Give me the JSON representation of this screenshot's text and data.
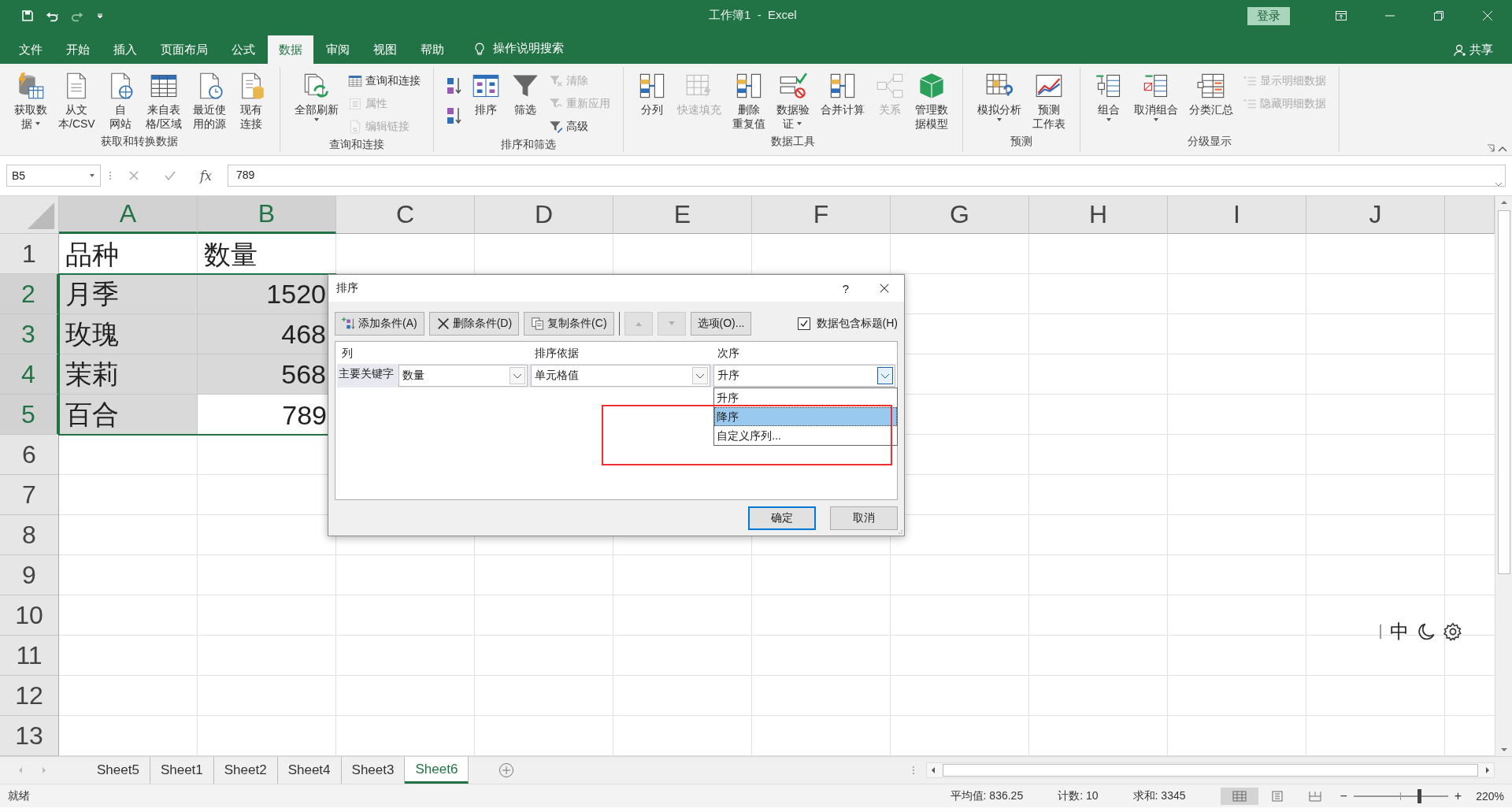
{
  "title_bar": {
    "title": "工作簿1  -  Excel",
    "signin": "登录"
  },
  "menu_tabs": [
    {
      "label": "文件",
      "selected": false
    },
    {
      "label": "开始",
      "selected": false
    },
    {
      "label": "插入",
      "selected": false
    },
    {
      "label": "页面布局",
      "selected": false
    },
    {
      "label": "公式",
      "selected": false
    },
    {
      "label": "数据",
      "selected": true
    },
    {
      "label": "审阅",
      "selected": false
    },
    {
      "label": "视图",
      "selected": false
    },
    {
      "label": "帮助",
      "selected": false
    }
  ],
  "tell_me": "操作说明搜索",
  "share": "共享",
  "ribbon": {
    "groups": [
      {
        "label": "获取和转换数据",
        "items": [
          {
            "kind": "large",
            "lines": [
              "获取数",
              "据"
            ],
            "dropdown": true,
            "disabled": false
          },
          {
            "kind": "large",
            "lines": [
              "从文",
              "本/CSV"
            ],
            "dropdown": false,
            "disabled": false
          },
          {
            "kind": "large",
            "lines": [
              "自",
              "网站"
            ],
            "dropdown": false,
            "disabled": false
          },
          {
            "kind": "large",
            "lines": [
              "来自表",
              "格/区域"
            ],
            "dropdown": false,
            "disabled": false
          },
          {
            "kind": "large",
            "lines": [
              "最近使",
              "用的源"
            ],
            "dropdown": false,
            "disabled": false
          },
          {
            "kind": "large",
            "lines": [
              "现有",
              "连接"
            ],
            "dropdown": false,
            "disabled": false
          }
        ]
      },
      {
        "label": "查询和连接",
        "items": [
          {
            "kind": "large",
            "lines": [
              "全部刷新"
            ],
            "dropdown": true,
            "disabled": false
          },
          {
            "kind": "stack",
            "items": [
              {
                "label": "查询和连接",
                "disabled": false
              },
              {
                "label": "属性",
                "disabled": true
              },
              {
                "label": "编辑链接",
                "disabled": true
              }
            ]
          }
        ]
      },
      {
        "label": "排序和筛选",
        "items": [
          {
            "kind": "sort_pair"
          },
          {
            "kind": "large",
            "lines": [
              "排序"
            ],
            "dropdown": false,
            "disabled": false
          },
          {
            "kind": "large",
            "lines": [
              "筛选"
            ],
            "dropdown": false,
            "disabled": false
          },
          {
            "kind": "stack",
            "items": [
              {
                "label": "清除",
                "disabled": true
              },
              {
                "label": "重新应用",
                "disabled": true
              },
              {
                "label": "高级",
                "disabled": false
              }
            ]
          }
        ]
      },
      {
        "label": "数据工具",
        "items": [
          {
            "kind": "large",
            "lines": [
              "分列"
            ],
            "dropdown": false,
            "disabled": false
          },
          {
            "kind": "large",
            "lines": [
              "快速填充"
            ],
            "dropdown": false,
            "disabled": true
          },
          {
            "kind": "large",
            "lines": [
              "删除",
              "重复值"
            ],
            "dropdown": false,
            "disabled": false
          },
          {
            "kind": "large",
            "lines": [
              "数据验",
              "证"
            ],
            "dropdown": true,
            "disabled": false
          },
          {
            "kind": "large",
            "lines": [
              "合并计算"
            ],
            "dropdown": false,
            "disabled": false
          },
          {
            "kind": "large",
            "lines": [
              "关系"
            ],
            "dropdown": false,
            "disabled": true
          },
          {
            "kind": "large",
            "lines": [
              "管理数",
              "据模型"
            ],
            "dropdown": false,
            "disabled": false
          }
        ]
      },
      {
        "label": "预测",
        "items": [
          {
            "kind": "large",
            "lines": [
              "模拟分析"
            ],
            "dropdown": true,
            "disabled": false
          },
          {
            "kind": "large",
            "lines": [
              "预测",
              "工作表"
            ],
            "dropdown": false,
            "disabled": false
          }
        ]
      },
      {
        "label": "分级显示",
        "items": [
          {
            "kind": "large",
            "lines": [
              "组合"
            ],
            "dropdown": true,
            "disabled": false
          },
          {
            "kind": "large",
            "lines": [
              "取消组合"
            ],
            "dropdown": true,
            "disabled": false
          },
          {
            "kind": "large",
            "lines": [
              "分类汇总"
            ],
            "dropdown": false,
            "disabled": false
          },
          {
            "kind": "stack",
            "items": [
              {
                "label": "显示明细数据",
                "disabled": true
              },
              {
                "label": "隐藏明细数据",
                "disabled": true
              }
            ]
          }
        ]
      }
    ]
  },
  "formula_bar": {
    "name_box": "B5",
    "fx": "fx",
    "value": "789"
  },
  "sheet": {
    "columns": [
      {
        "label": "A",
        "selected": true
      },
      {
        "label": "B",
        "selected": true
      },
      {
        "label": "C",
        "selected": false
      },
      {
        "label": "D",
        "selected": false
      },
      {
        "label": "E",
        "selected": false
      },
      {
        "label": "F",
        "selected": false
      },
      {
        "label": "G",
        "selected": false
      },
      {
        "label": "H",
        "selected": false
      },
      {
        "label": "I",
        "selected": false
      },
      {
        "label": "J",
        "selected": false
      }
    ],
    "rows": [
      {
        "label": "1",
        "selected": false,
        "cells": [
          {
            "text": "品种",
            "kind": "text"
          },
          {
            "text": "数量",
            "kind": "text"
          }
        ]
      },
      {
        "label": "2",
        "selected": true,
        "cells": [
          {
            "text": "月季",
            "kind": "text",
            "active": false
          },
          {
            "text": "1520",
            "kind": "number",
            "active": false
          }
        ]
      },
      {
        "label": "3",
        "selected": true,
        "cells": [
          {
            "text": "玫瑰",
            "kind": "text",
            "active": false
          },
          {
            "text": "468",
            "kind": "number",
            "active": false
          }
        ]
      },
      {
        "label": "4",
        "selected": true,
        "cells": [
          {
            "text": "茉莉",
            "kind": "text",
            "active": false
          },
          {
            "text": "568",
            "kind": "number",
            "active": false
          }
        ]
      },
      {
        "label": "5",
        "selected": true,
        "cells": [
          {
            "text": "百合",
            "kind": "text",
            "active": false
          },
          {
            "text": "789",
            "kind": "number",
            "active": true
          }
        ]
      },
      {
        "label": "6",
        "selected": false,
        "cells": []
      },
      {
        "label": "7",
        "selected": false,
        "cells": []
      },
      {
        "label": "8",
        "selected": false,
        "cells": []
      },
      {
        "label": "9",
        "selected": false,
        "cells": []
      },
      {
        "label": "10",
        "selected": false,
        "cells": []
      },
      {
        "label": "11",
        "selected": false,
        "cells": []
      },
      {
        "label": "12",
        "selected": false,
        "cells": []
      },
      {
        "label": "13",
        "selected": false,
        "cells": []
      }
    ]
  },
  "sort_dialog": {
    "title": "排序",
    "help": "?",
    "toolbar": [
      {
        "label": "添加条件(A)",
        "kind": "add"
      },
      {
        "label": "删除条件(D)",
        "kind": "delete"
      },
      {
        "label": "复制条件(C)",
        "kind": "copy"
      }
    ],
    "move_buttons": [
      {
        "kind": "up",
        "disabled": true
      },
      {
        "kind": "down",
        "disabled": true
      }
    ],
    "options": "选项(O)...",
    "has_headers": {
      "label": "数据包含标题(H)",
      "checked": true
    },
    "headers": [
      "列",
      "排序依据",
      "次序"
    ],
    "levels": [
      {
        "label": "主要关键字",
        "column": "数量",
        "sort_on": "单元格值",
        "order": "升序"
      }
    ],
    "order_options": [
      {
        "label": "升序",
        "selected": false
      },
      {
        "label": "降序",
        "selected": true
      },
      {
        "label": "自定义序列...",
        "selected": false
      }
    ],
    "ok": "确定",
    "cancel": "取消"
  },
  "sheet_tabs": [
    {
      "label": "Sheet5",
      "selected": false
    },
    {
      "label": "Sheet1",
      "selected": false
    },
    {
      "label": "Sheet2",
      "selected": false
    },
    {
      "label": "Sheet4",
      "selected": false
    },
    {
      "label": "Sheet3",
      "selected": false
    },
    {
      "label": "Sheet6",
      "selected": true
    }
  ],
  "status_bar": {
    "ready": "就绪",
    "average": "平均值: 836.25",
    "count": "计数: 10",
    "sum": "求和: 3345",
    "zoom_out": "−",
    "zoom_in": "+",
    "zoom": "220%",
    "zoom_slider": {
      "level": 0.7
    }
  },
  "ime": {
    "mode": "中"
  }
}
